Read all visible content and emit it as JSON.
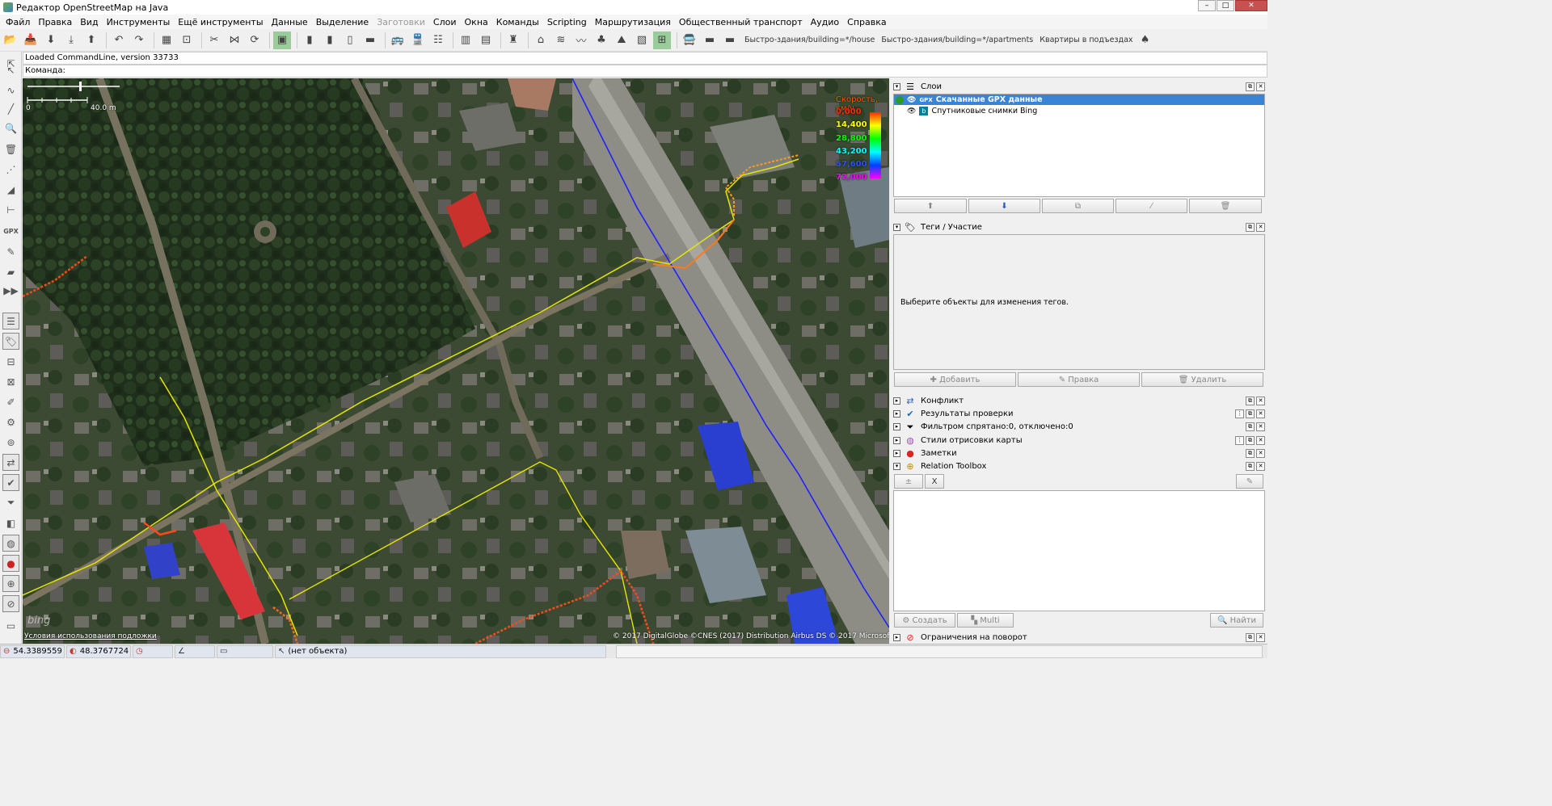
{
  "window": {
    "title": "Редактор OpenStreetMap на Java"
  },
  "menu": [
    "Файл",
    "Правка",
    "Вид",
    "Инструменты",
    "Ещё инструменты",
    "Данные",
    "Выделение",
    "Заготовки",
    "Слои",
    "Окна",
    "Команды",
    "Scripting",
    "Маршрутизация",
    "Общественный транспорт",
    "Аудио",
    "Справка"
  ],
  "menu_disabled": "Заготовки",
  "toolbar": {
    "text_buttons": [
      "Быстро-здания/building=*/house",
      "Быстро-здания/building=*/apartments",
      "Квартиры в подъездах"
    ]
  },
  "commandline": {
    "loaded": "Loaded CommandLine, version 33733",
    "prompt": "Команда:"
  },
  "map": {
    "scale_label": "40.0 m",
    "scale_zero": "0",
    "legend_title": "Скорость, км/ч",
    "legend_values": [
      "0,000",
      "14,400",
      "28,800",
      "43,200",
      "57,600",
      "72,000"
    ],
    "legend_colors": [
      "#ff2a00",
      "#ffff00",
      "#00ff00",
      "#00ffff",
      "#0040ff",
      "#ff00ff"
    ],
    "attribution": "© 2017 DigitalGlobe ©CNES (2017) Distribution Airbus DS © 2017 Microsoft Corporation",
    "terms": "Условия использования подложки",
    "bing": "bing"
  },
  "layers_panel": {
    "title": "Слои",
    "layers": [
      {
        "name": "Скачанные GPX данные",
        "selected": true,
        "icon": "gpx-icon"
      },
      {
        "name": "Спутниковые снимки Bing",
        "selected": false,
        "icon": "bing-icon"
      }
    ]
  },
  "tags_panel": {
    "title": "Теги / Участие",
    "empty_text": "Выберите объекты для изменения тегов.",
    "buttons": {
      "add": "Добавить",
      "edit": "Правка",
      "delete": "Удалить"
    }
  },
  "collapsed_panels": [
    {
      "title": "Конфликт",
      "icon": "conflict-icon"
    },
    {
      "title": "Результаты проверки",
      "icon": "validation-icon"
    },
    {
      "title": "Фильтром спрятано:0, отключено:0",
      "icon": "filter-icon"
    },
    {
      "title": "Стили отрисовки карты",
      "icon": "map-style-icon"
    },
    {
      "title": "Заметки",
      "icon": "notes-icon"
    }
  ],
  "relation_toolbox": {
    "title": "Relation Toolbox",
    "clear_btn": "X",
    "buttons": {
      "create": "Создать",
      "multi": "Multi",
      "find": "Найти"
    }
  },
  "turn_restrictions": {
    "title": "Ограничения на поворот"
  },
  "statusbar": {
    "lat": "54.3389559",
    "lon": "48.3767724",
    "object": "(нет объекта)"
  }
}
